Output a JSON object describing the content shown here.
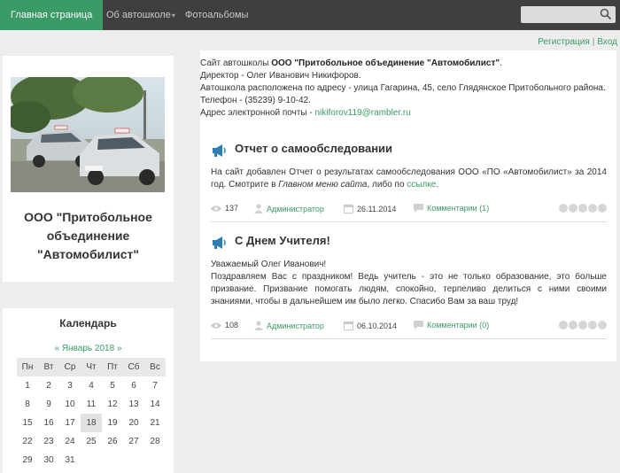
{
  "nav": {
    "home": "Главная страница",
    "about": "Об автошколе",
    "about_caret": "▾",
    "albums": "Фотоальбомы"
  },
  "toplinks": {
    "register": "Регистрация",
    "sep": "|",
    "login": "Вход"
  },
  "org": {
    "title_line1": "ООО \"Притобольное",
    "title_line2": "объединение",
    "title_line3": "\"Автомобилист\""
  },
  "calendar": {
    "title": "Календарь",
    "nav": "«  Январь 2018  »",
    "days": [
      "Пн",
      "Вт",
      "Ср",
      "Чт",
      "Пт",
      "Сб",
      "Вс"
    ],
    "weeks": [
      [
        "1",
        "2",
        "3",
        "4",
        "5",
        "6",
        "7"
      ],
      [
        "8",
        "9",
        "10",
        "11",
        "12",
        "13",
        "14"
      ],
      [
        "15",
        "16",
        "17",
        "18",
        "19",
        "20",
        "21"
      ],
      [
        "22",
        "23",
        "24",
        "25",
        "26",
        "27",
        "28"
      ],
      [
        "29",
        "30",
        "31",
        "",
        "",
        "",
        ""
      ]
    ],
    "today": "18"
  },
  "intro": {
    "l1a": "Сайт автошколы ",
    "l1b": "ООО \"Притобольное объединение \"Автомобилист\"",
    "l1c": ".",
    "l2": "Директор - Олег Иванович Никифоров.",
    "l3": "Автошкола расположена по адресу - улица Гагарина, 45, село Глядянское Притобольного района.",
    "l4": "Телефон - (35239) 9-10-42.",
    "l5a": "Адрес электронной почты - ",
    "l5b": "nikiforov119@rambler.ru"
  },
  "posts": [
    {
      "title": "Отчет о самообследовании",
      "body1": "На сайт добавлен Отчет о результатах самообследования ООО «ПО «Автомобилист» за 2014 год. Смотрите в ",
      "body_italic": "Главном меню сайта",
      "body2": ", либо по ",
      "body_link": "ссылке",
      "body3": ".",
      "views": "137",
      "author": "Администратор",
      "date": "26.11.2014",
      "comments": "Комментарии (1)"
    },
    {
      "title": "С Днем Учителя!",
      "body_l1": "Уважаемый Олег Иванович!",
      "body_l2": "Поздравляем Вас с праздником! Ведь учитель - это не только образование, это больше призвание. Призвание помогать людям, спокойно, терпеливо делиться с ними своими знаниями, чтобы в дальнейшем им было легко. Спасибо Вам за ваш труд!",
      "views": "108",
      "author": "Администратор",
      "date": "06.10.2014",
      "comments": "Комментарии (0)"
    }
  ],
  "colors": {
    "accent": "#3a9b66",
    "nav_bg": "#3f3f3f",
    "page_bg": "#ededed"
  }
}
